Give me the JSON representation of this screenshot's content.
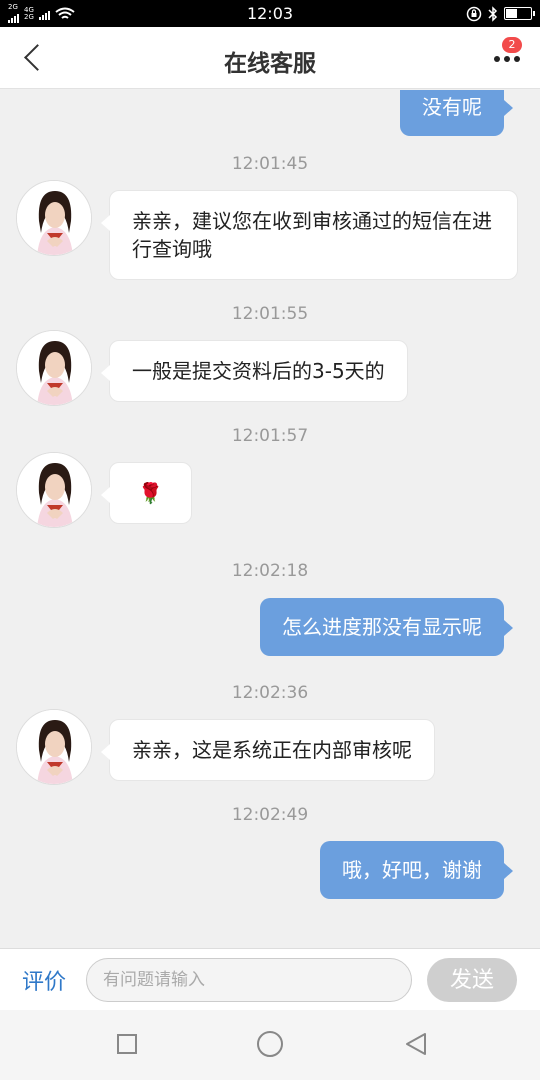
{
  "status_bar": {
    "time": "12:03",
    "sim1_label": "2G",
    "sim2_label": "4G",
    "sim2_sub": "2G",
    "battery_level": 0.45
  },
  "header": {
    "title": "在线客服",
    "badge_count": "2"
  },
  "messages": [
    {
      "type": "out",
      "text": "没有呢"
    },
    {
      "type": "time",
      "text": "12:01:45"
    },
    {
      "type": "in",
      "text": "亲亲，建议您在收到审核通过的短信在进行查询哦"
    },
    {
      "type": "time",
      "text": "12:01:55"
    },
    {
      "type": "in",
      "text": "一般是提交资料后的3-5天的"
    },
    {
      "type": "time",
      "text": "12:01:57"
    },
    {
      "type": "in",
      "text": "🌹"
    },
    {
      "type": "time",
      "text": "12:02:18"
    },
    {
      "type": "out",
      "text": "怎么进度那没有显示呢"
    },
    {
      "type": "time",
      "text": "12:02:36"
    },
    {
      "type": "in",
      "text": "亲亲，这是系统正在内部审核呢"
    },
    {
      "type": "time",
      "text": "12:02:49"
    },
    {
      "type": "out",
      "text": "哦，好吧，谢谢"
    }
  ],
  "input_bar": {
    "rate_label": "评价",
    "placeholder": "有问题请输入",
    "value": "",
    "send_label": "发送"
  },
  "colors": {
    "accent": "#6b9fde",
    "link": "#2f78c8",
    "badge": "#f24b4b"
  }
}
